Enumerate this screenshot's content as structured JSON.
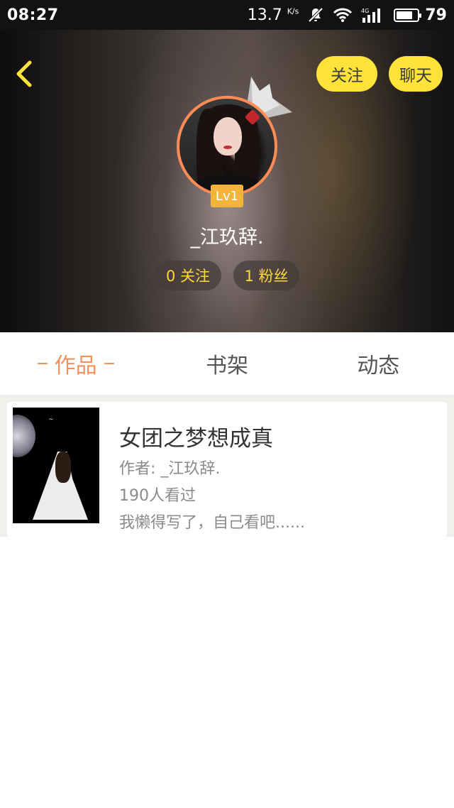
{
  "status_bar": {
    "time": "08:27",
    "speed": "13.7",
    "speed_unit": "K/s",
    "network_type": "4G",
    "battery": "79",
    "battery_level": 0.79,
    "icons": [
      "notifications-off-icon",
      "wifi-icon",
      "signal-icon",
      "battery-icon"
    ]
  },
  "header": {
    "back_icon": "chevron-left-icon",
    "follow_label": "关注",
    "chat_label": "聊天",
    "accent_color": "#ffe23a"
  },
  "profile": {
    "level": "Lv1",
    "username": "_江玖辞.",
    "following": "0 关注",
    "fans": "1 粉丝",
    "avatar_ring_color": "#ff8c55"
  },
  "tabs": [
    {
      "label": "作品",
      "active": true
    },
    {
      "label": "书架",
      "active": false
    },
    {
      "label": "动态",
      "active": false
    }
  ],
  "books": [
    {
      "title": "女团之梦想成真",
      "author": "作者: _江玖辞.",
      "views": "190人看过",
      "description": "我懒得写了，自己看吧......"
    }
  ]
}
